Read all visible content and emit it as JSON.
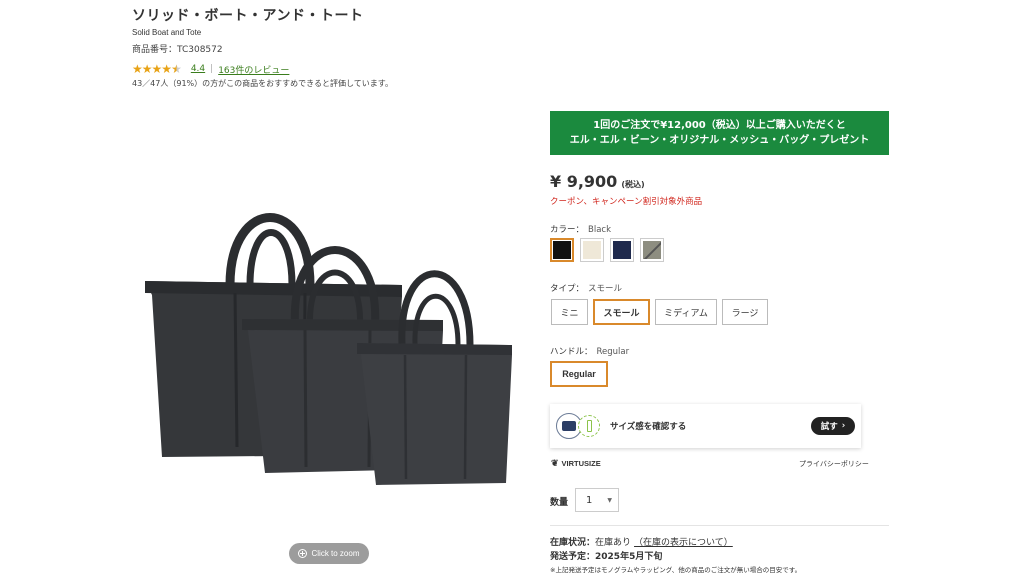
{
  "product": {
    "title": "ソリッド・ボート・アンド・トート",
    "subtitle": "Solid Boat and Tote",
    "sku": "商品番号：TC308572",
    "rating": "4.4",
    "rating_stars": 4.4,
    "reviews_link": "163件のレビュー",
    "recommend_text": "43／47人（91%）の方がこの商品をおすすめできると評価しています。"
  },
  "image": {
    "zoom_label": "Click to zoom"
  },
  "promo": {
    "line1": "1回のご注文で¥12,000（税込）以上ご購入いただくと",
    "line2": "エル・エル・ビーン・オリジナル・メッシュ・バッグ・プレゼント",
    "color": "#1b8a3e"
  },
  "price": {
    "amount": "¥ 9,900",
    "tax_label": "(税込)",
    "coupon_note": "クーポン、キャンペーン割引対象外商品"
  },
  "color": {
    "label": "カラー：",
    "selected": "Black",
    "swatches": [
      {
        "name": "Black",
        "hex": "#111111",
        "selected": true
      },
      {
        "name": "Natural",
        "hex": "#efe8d8",
        "selected": false
      },
      {
        "name": "Navy",
        "hex": "#1f2a4d",
        "selected": false
      },
      {
        "name": "Gray",
        "hex": "#8d8d80",
        "selected": false
      }
    ]
  },
  "type": {
    "label": "タイプ：",
    "selected": "スモール",
    "options": [
      "ミニ",
      "スモール",
      "ミディアム",
      "ラージ"
    ]
  },
  "handle": {
    "label": "ハンドル：",
    "selected": "Regular",
    "option": "Regular"
  },
  "size_check": {
    "text": "サイズ感を確認する",
    "button": "試す",
    "brand": "VIRTUSIZE",
    "privacy": "プライバシーポリシー"
  },
  "quantity": {
    "label": "数量",
    "value": "1"
  },
  "stock": {
    "label": "在庫状況：",
    "value": "在庫あり",
    "link": "（在庫の表示について）",
    "ship_label": "発送予定：",
    "ship_value": "2025年5月下旬",
    "note": "※上記発送予定はモノグラムやラッピング、他の商品のご注文が無い場合の目安です。"
  },
  "colors": {
    "accent_selected": "#d9892b",
    "link_green": "#3a7d1c",
    "alert_red": "#d0241b"
  }
}
